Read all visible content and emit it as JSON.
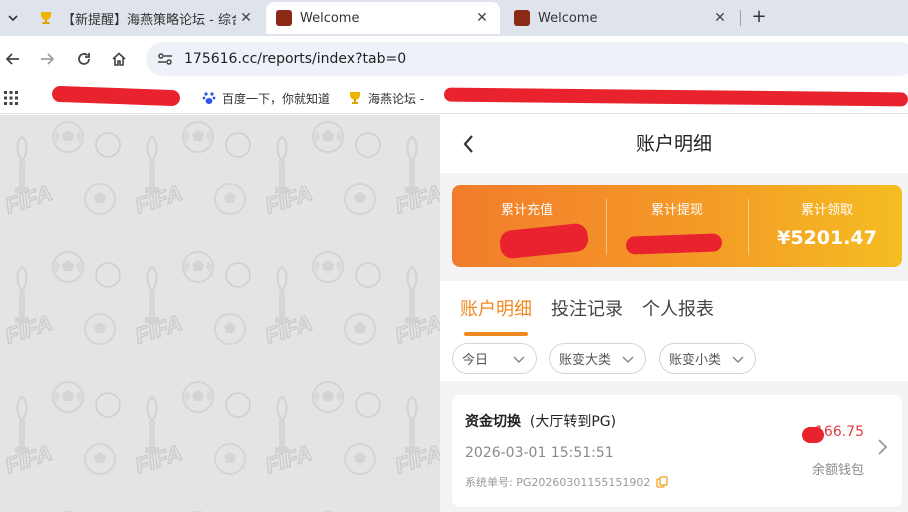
{
  "browser": {
    "tabs": [
      {
        "title": "【新提醒】海燕策略论坛 - 综合",
        "active": false
      },
      {
        "title": "Welcome",
        "active": true
      },
      {
        "title": "Welcome",
        "active": false
      }
    ],
    "new_tab_label": "+",
    "url": "175616.cc/reports/index?tab=0",
    "bookmarks": [
      {
        "label": "百度一下，你就知道",
        "icon": "baidu-paw-icon"
      },
      {
        "label": "海燕论坛 -",
        "icon": "trophy-icon"
      }
    ]
  },
  "page": {
    "title": "账户明细",
    "summary": [
      {
        "label": "累计充值",
        "value": ""
      },
      {
        "label": "累计提现",
        "value": ""
      },
      {
        "label": "累计领取",
        "value": "¥5201.47"
      }
    ],
    "tabs": [
      "账户明细",
      "投注记录",
      "个人报表"
    ],
    "active_tab": 0,
    "filters": [
      "今日",
      "账变大类",
      "账变小类"
    ],
    "records": [
      {
        "type": "资金切换",
        "detail": "(大厅转到PG)",
        "datetime": "2026-03-01 15:51:51",
        "order_label": "系统单号:",
        "order_no": "PG20260301155151902",
        "amount": "166.75",
        "wallet": "余额钱包"
      }
    ]
  },
  "colors": {
    "accent": "#f08a20",
    "card_gradient_start": "#f27c2c",
    "card_gradient_end": "#f5bd22",
    "amount_red": "#e23b3b",
    "redaction": "#e8232d"
  }
}
